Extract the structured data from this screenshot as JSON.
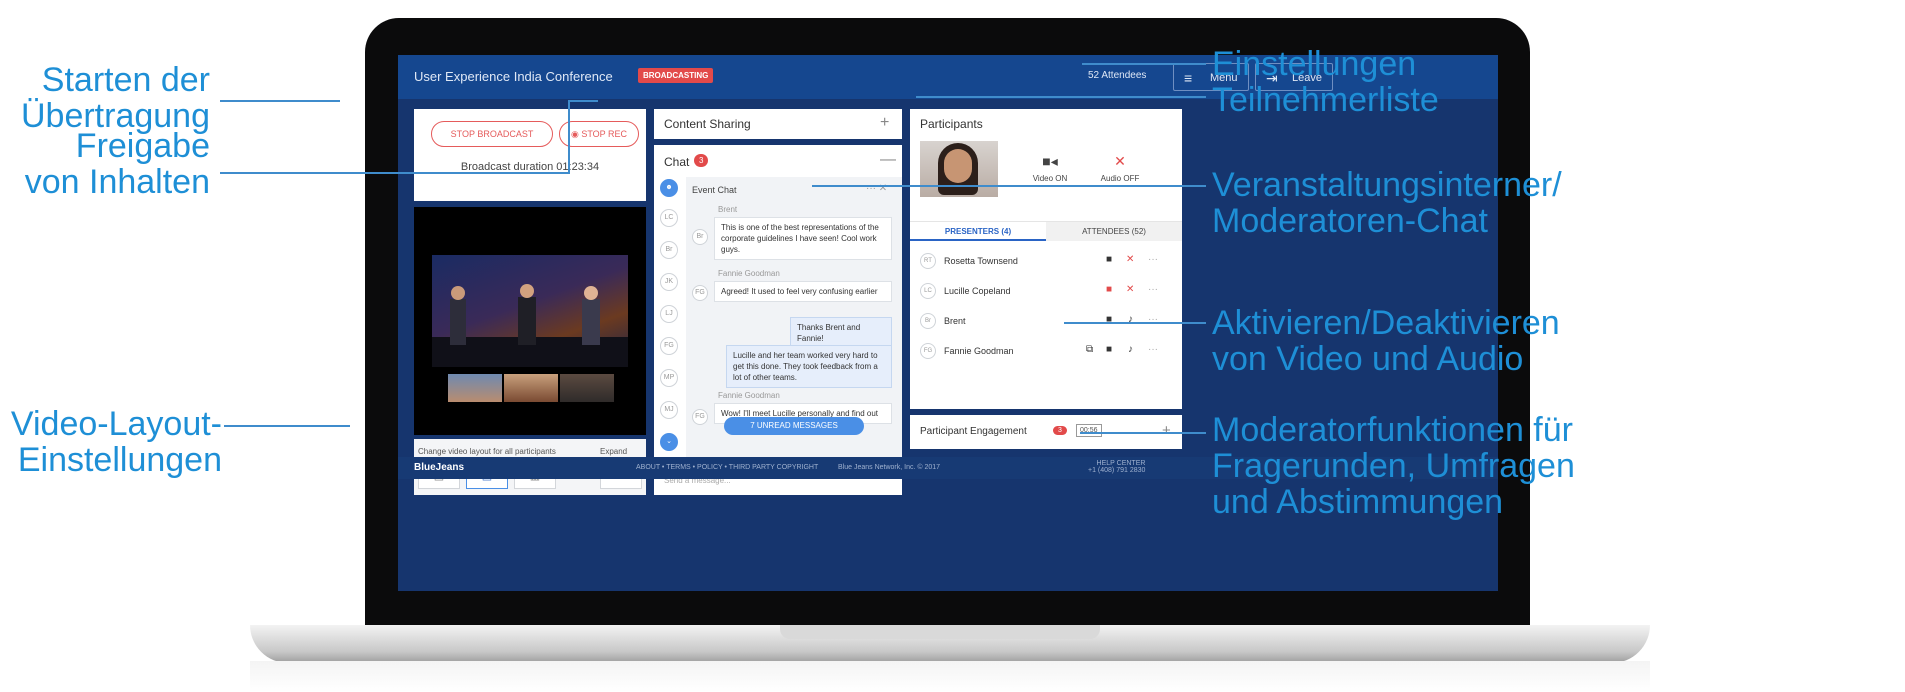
{
  "callouts": {
    "left": {
      "start_broadcast": [
        "Starten der",
        "Übertragung"
      ],
      "share_content": [
        "Freigabe",
        "von Inhalten"
      ],
      "video_layout": [
        "Video-Layout-",
        "Einstellungen"
      ]
    },
    "right": {
      "settings_participants": [
        "Einstellungen",
        "Teilnehmerliste"
      ],
      "event_chat": [
        "Veranstaltungsinterner/",
        "Moderatoren-Chat"
      ],
      "toggle_av": [
        "Aktivieren/Deaktivieren",
        "von Video und Audio"
      ],
      "moderator_functions": [
        "Moderatorfunktionen für",
        "Fragerunden, Umfragen",
        "und Abstimmungen"
      ]
    }
  },
  "app": {
    "title": "User Experience India Conference",
    "status_badge": "BROADCASTING",
    "attendees": "52 Attendees",
    "menu_label": "Menu",
    "leave_label": "Leave"
  },
  "broadcast": {
    "stop_broadcast": "STOP BROADCAST",
    "stop_rec": "STOP REC",
    "duration": "Broadcast duration 01:23:34"
  },
  "layout": {
    "label": "Change video layout for all participants",
    "expand_label": "Expand"
  },
  "content_sharing": {
    "title": "Content Sharing",
    "add": "+"
  },
  "chat": {
    "title": "Chat",
    "count": "3",
    "collapse": "—",
    "room": "Event Chat",
    "avatars": [
      "LC",
      "Br",
      "JK",
      "LJ",
      "FG",
      "MP",
      "MJ"
    ],
    "messages": [
      {
        "sender": "Brent",
        "initials": "Br",
        "text": "This is one of the best representations of the corporate guidelines I have seen! Cool work guys."
      },
      {
        "sender": "Fannie Goodman",
        "initials": "FG",
        "text": "Agreed! It used to feel very confusing earlier"
      },
      {
        "sender": "",
        "initials": "",
        "text": "Thanks Brent and Fannie!"
      },
      {
        "sender": "",
        "initials": "",
        "text": "Lucille and her team worked very hard to get this done. They took feedback from a lot of other teams."
      },
      {
        "sender": "Fannie Goodman",
        "initials": "FG",
        "text": "Wow! I'll meet Lucille personally and find out"
      }
    ],
    "unread": "7 UNREAD MESSAGES",
    "placeholder": "Send a message..."
  },
  "participants": {
    "title": "Participants",
    "video_label": "Video ON",
    "audio_label": "Audio OFF",
    "tabs": [
      "PRESENTERS (4)",
      "ATTENDEES (52)"
    ],
    "list": [
      {
        "initials": "RT",
        "name": "Rosetta Townsend"
      },
      {
        "initials": "LC",
        "name": "Lucille Copeland"
      },
      {
        "initials": "Br",
        "name": "Brent"
      },
      {
        "initials": "FG",
        "name": "Fannie Goodman"
      }
    ]
  },
  "engagement": {
    "title": "Participant Engagement",
    "count": "3",
    "timer": "00:56",
    "add": "+"
  },
  "footer": {
    "brand": "BlueJeans",
    "links": "ABOUT  •  TERMS  •  POLICY  •  THIRD PARTY COPYRIGHT",
    "copyright": "Blue Jeans Network, Inc. © 2017",
    "help_center": "HELP CENTER",
    "phone": "+1 (408) 791 2830"
  },
  "colors": {
    "accent": "#1e8fd6",
    "topbar": "#15478f",
    "alert": "#e24a4a"
  }
}
